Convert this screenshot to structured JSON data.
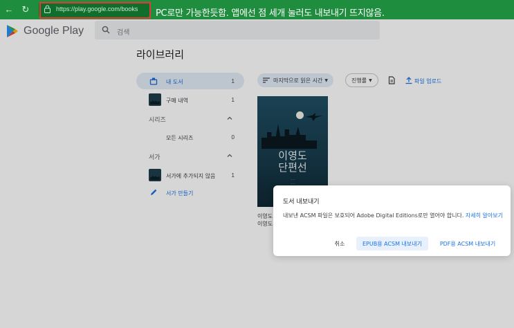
{
  "browser": {
    "url": "https://play.google.com/books",
    "annotation": "PC로만 가능한듯함. 앱에선 점 세개 눌러도 내보내기 뜨지않음."
  },
  "header": {
    "brand": "Google Play",
    "search_placeholder": "검색"
  },
  "library": {
    "title": "라이브러리"
  },
  "sidebar": {
    "my_books": {
      "label": "내 도서",
      "count": "1"
    },
    "purchases": {
      "label": "구매 내역",
      "count": "1"
    },
    "series_section": "시리즈",
    "all_series": {
      "label": "모든 시리즈",
      "count": "0"
    },
    "shelves_section": "서가",
    "not_on_shelf": {
      "label": "서가에 추가되지 않음",
      "count": "1"
    },
    "create_shelf": "서가 만들기"
  },
  "toolbar": {
    "sort_label": "마지막으로 읽은 시간",
    "progress_label": "진행률",
    "upload_label": "파일 업로드"
  },
  "book": {
    "cover_title_line1": "이영도",
    "cover_title_line2": "단편선",
    "caption_line1": "이영도",
    "caption_line2": "이영도"
  },
  "dialog": {
    "title": "도서 내보내기",
    "body": "내보낸 ACSM 파일은 보호되어 Adobe Digital Editions로만 열어야 합니다.",
    "link": "자세히 알아보기",
    "cancel": "취소",
    "epub": "EPUB용 ACSM 내보내기",
    "pdf": "PDF용 ACSM 내보내기"
  },
  "colors": {
    "chrome": "#1e8e3e",
    "accent": "#1a73e8",
    "active_bg": "#e2ebf7",
    "highlight": "#e53935"
  }
}
